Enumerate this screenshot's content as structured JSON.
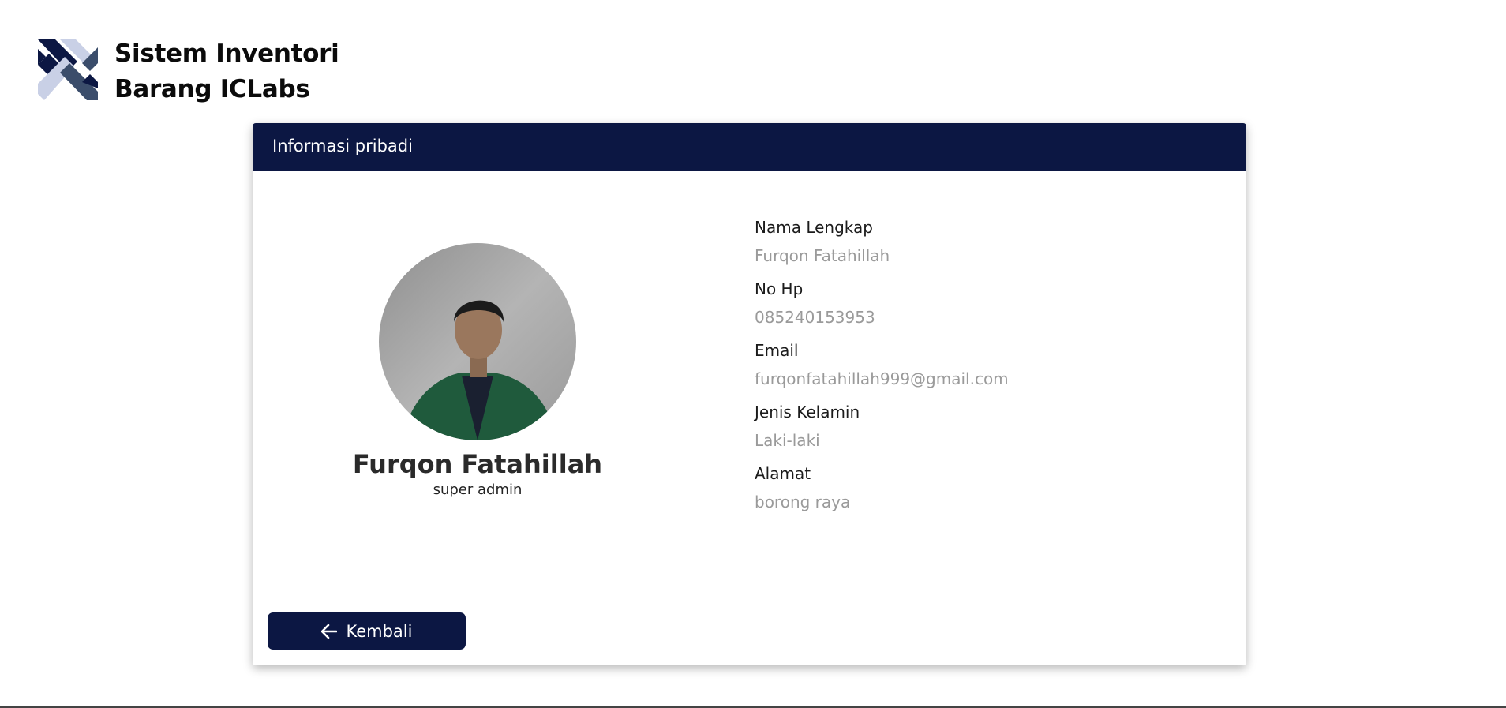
{
  "brand": {
    "title_line1": "Sistem Inventori",
    "title_line2": "Barang ICLabs",
    "logo_icon": "iclabs-logo"
  },
  "card": {
    "header_title": "Informasi pribadi"
  },
  "profile": {
    "name": "Furqon Fatahillah",
    "role": "super admin",
    "avatar_icon": "user-photo"
  },
  "info": {
    "fields": [
      {
        "label": "Nama Lengkap",
        "value": "Furqon Fatahillah"
      },
      {
        "label": "No Hp",
        "value": "085240153953"
      },
      {
        "label": "Email",
        "value": "furqonfatahillah999@gmail.com"
      },
      {
        "label": "Jenis Kelamin",
        "value": "Laki-laki"
      },
      {
        "label": "Alamat",
        "value": "borong raya"
      }
    ]
  },
  "actions": {
    "back_label": "Kembali",
    "back_icon": "arrow-left-icon"
  },
  "colors": {
    "primary": "#0c1743",
    "muted_text": "#9a9a9a"
  }
}
